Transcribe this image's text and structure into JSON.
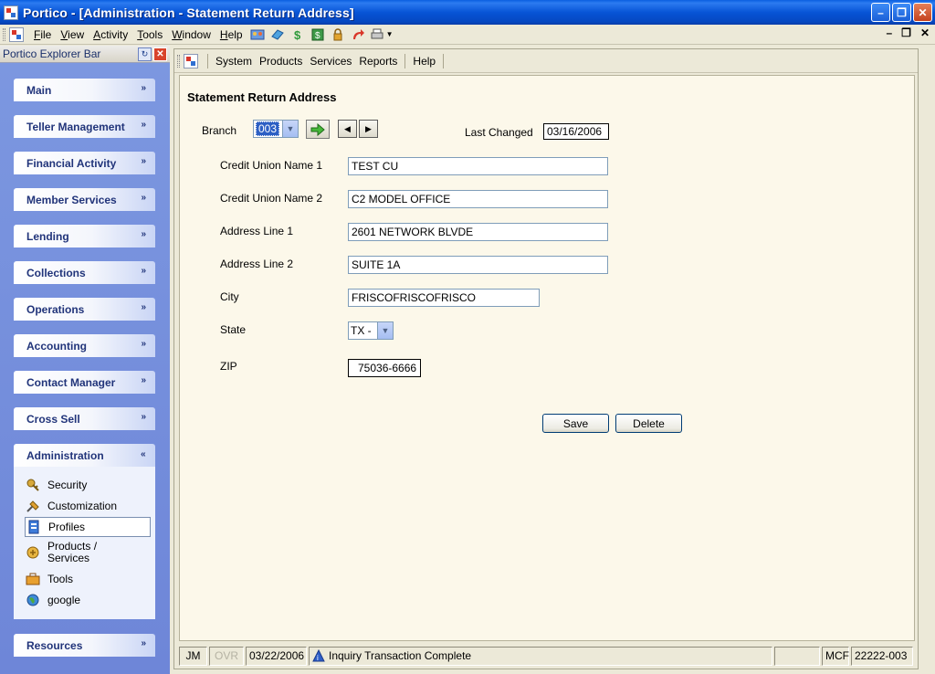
{
  "window": {
    "title": "Portico - [Administration - Statement Return Address]"
  },
  "menubar": {
    "items": [
      "File",
      "View",
      "Activity",
      "Tools",
      "Window",
      "Help"
    ],
    "underline": [
      "F",
      "V",
      "A",
      "T",
      "W",
      "H"
    ]
  },
  "explorer": {
    "title": "Portico Explorer Bar",
    "groups": [
      "Main",
      "Teller Management",
      "Financial Activity",
      "Member Services",
      "Lending",
      "Collections",
      "Operations",
      "Accounting",
      "Contact Manager",
      "Cross Sell",
      "Administration",
      "Resources"
    ],
    "admin_items": [
      {
        "label": "Security",
        "icon": "key-icon"
      },
      {
        "label": "Customization",
        "icon": "tools-icon"
      },
      {
        "label": "Profiles",
        "icon": "profile-icon"
      },
      {
        "label": "Products / Services",
        "icon": "products-icon"
      },
      {
        "label": "Tools",
        "icon": "toolbox-icon"
      },
      {
        "label": "google",
        "icon": "globe-icon"
      }
    ]
  },
  "subtoolbar": {
    "items": [
      "System",
      "Products",
      "Services",
      "Reports",
      "Help"
    ]
  },
  "form": {
    "title": "Statement Return Address",
    "branch_label": "Branch",
    "branch_value": "003",
    "last_changed_label": "Last Changed",
    "last_changed_value": "03/16/2006",
    "cu_name1_label": "Credit Union Name 1",
    "cu_name1_value": "TEST CU",
    "cu_name2_label": "Credit Union Name 2",
    "cu_name2_value": "C2 MODEL OFFICE",
    "addr1_label": "Address Line 1",
    "addr1_value": "2601 NETWORK BLVDE",
    "addr2_label": "Address Line 2",
    "addr2_value": "SUITE 1A",
    "city_label": "City",
    "city_value": "FRISCOFRISCOFRISCO",
    "state_label": "State",
    "state_value": "TX -",
    "zip_label": "ZIP",
    "zip_value": "75036-6666",
    "save_label": "Save",
    "delete_label": "Delete"
  },
  "status": {
    "user": "JM",
    "ovr": "OVR",
    "date": "03/22/2006",
    "message": "Inquiry Transaction Complete",
    "mode": "MCF",
    "code": "22222-003"
  }
}
